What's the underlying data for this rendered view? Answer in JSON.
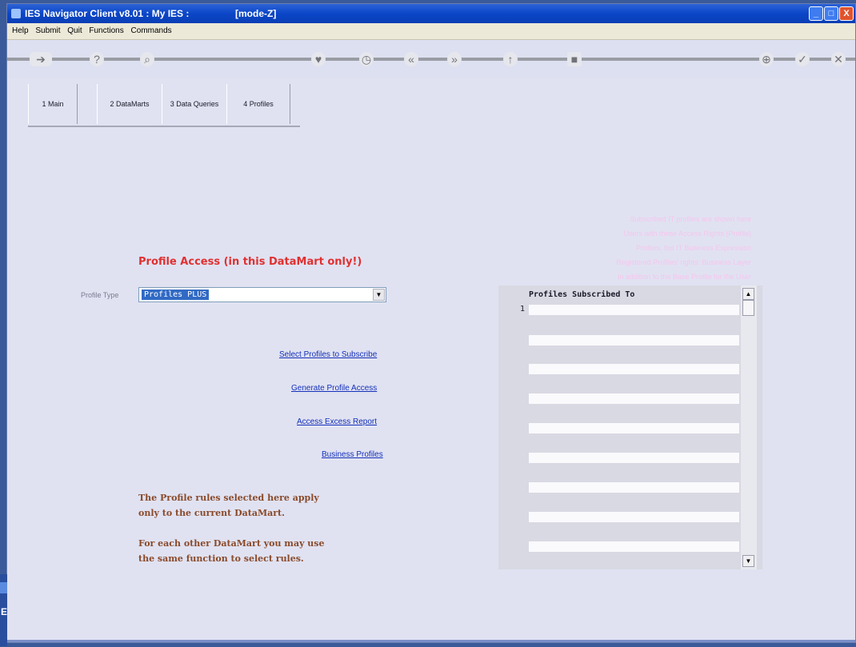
{
  "window": {
    "title": "IES Navigator Client v8.01 : My IES :",
    "mode": "[mode-Z]",
    "min_label": "_",
    "max_label": "□",
    "close_label": "X"
  },
  "menu": [
    "Help",
    "Submit",
    "Quit",
    "Functions",
    "Commands"
  ],
  "toolbar": {
    "icons": [
      "arrow-icon",
      "help-icon",
      "search-icon",
      "heart-icon",
      "clock-icon",
      "prev-icon",
      "next-icon",
      "up-icon",
      "stop-icon",
      "zoom-icon",
      "check-icon",
      "close-icon"
    ]
  },
  "tabs": [
    "1 Main",
    "2 DataMarts",
    "3 Data Queries",
    "4 Profiles"
  ],
  "help_text": [
    "Subscribed IT profiles are shown here",
    "Users with these Access Rights (Profile)",
    "Profiles, but IT Business Expression",
    "Registered Profiles' rights: Business Layer",
    "In addition to the Base Profile for the User"
  ],
  "form": {
    "heading": "Profile Access (in this DataMart only!)",
    "profile_type_label": "Profile Type",
    "profile_type_value": "Profiles PLUS",
    "arrow": "▼"
  },
  "links": {
    "select_profiles": "Select Profiles to Subscribe",
    "generate_access": "Generate Profile Access",
    "access_excess": "Access Excess Report",
    "business_profiles": "Business Profiles"
  },
  "notes": {
    "line1": "The Profile rules selected here apply",
    "line2": "only to the current DataMart.",
    "line3": "For each other DataMart you may use",
    "line4": "the same function to select rules."
  },
  "grid": {
    "header": "Profiles Subscribed To",
    "row_number": "1",
    "scroll_up": "▲",
    "scroll_down": "▼"
  },
  "taskbar": {
    "label": "E"
  }
}
